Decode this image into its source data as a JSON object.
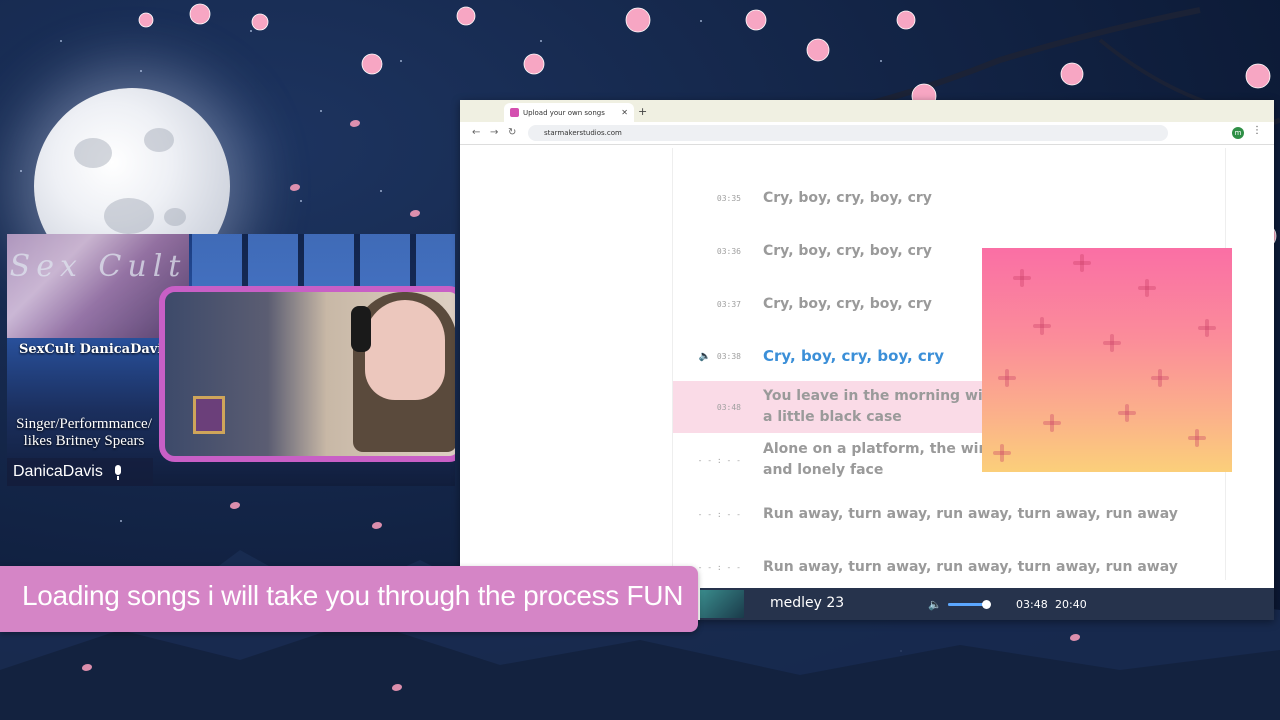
{
  "webcam": {
    "poster_text": "Sex Cult",
    "channel_title": "SexCult DanicaDavis",
    "bio": "Singer/Performmance/ likes Britney Spears",
    "username": "DanicaDavis",
    "mic_icon": "microphone-icon"
  },
  "browser": {
    "tab_title": "Upload your own songs",
    "url": "starmakerstudios.com",
    "avatar_letter": "m"
  },
  "lyrics": [
    {
      "time": "03:35",
      "text": "Cry, boy, cry, boy, cry"
    },
    {
      "time": "03:36",
      "text": "Cry, boy, cry, boy, cry"
    },
    {
      "time": "03:37",
      "text": "Cry, boy, cry, boy, cry"
    },
    {
      "time": "03:38",
      "text": "Cry, boy, cry, boy, cry"
    },
    {
      "time": "03:48",
      "text1": "You leave in the morning with e",
      "text2": "a little black case"
    },
    {
      "time": "- - : - -",
      "text1": "Alone on a platform, the wind a",
      "text2": "and lonely face"
    },
    {
      "time": "- - : - -",
      "text": "Run away, turn away, run away, turn away, run away"
    },
    {
      "time": "- - : - -",
      "text": "Run away, turn away, run away, turn away, run away"
    }
  ],
  "player": {
    "song_title": "medley 23",
    "current_time": "03:48",
    "total_time": "20:40",
    "volume_fraction": 0.9
  },
  "banner": {
    "text": "Loading songs i will take you through the process FUN"
  },
  "colors": {
    "accent_pink": "#d585c6",
    "current_line": "#3b8fd8",
    "highlight_row": "#fadbe7",
    "player_bg": "#26334c"
  }
}
